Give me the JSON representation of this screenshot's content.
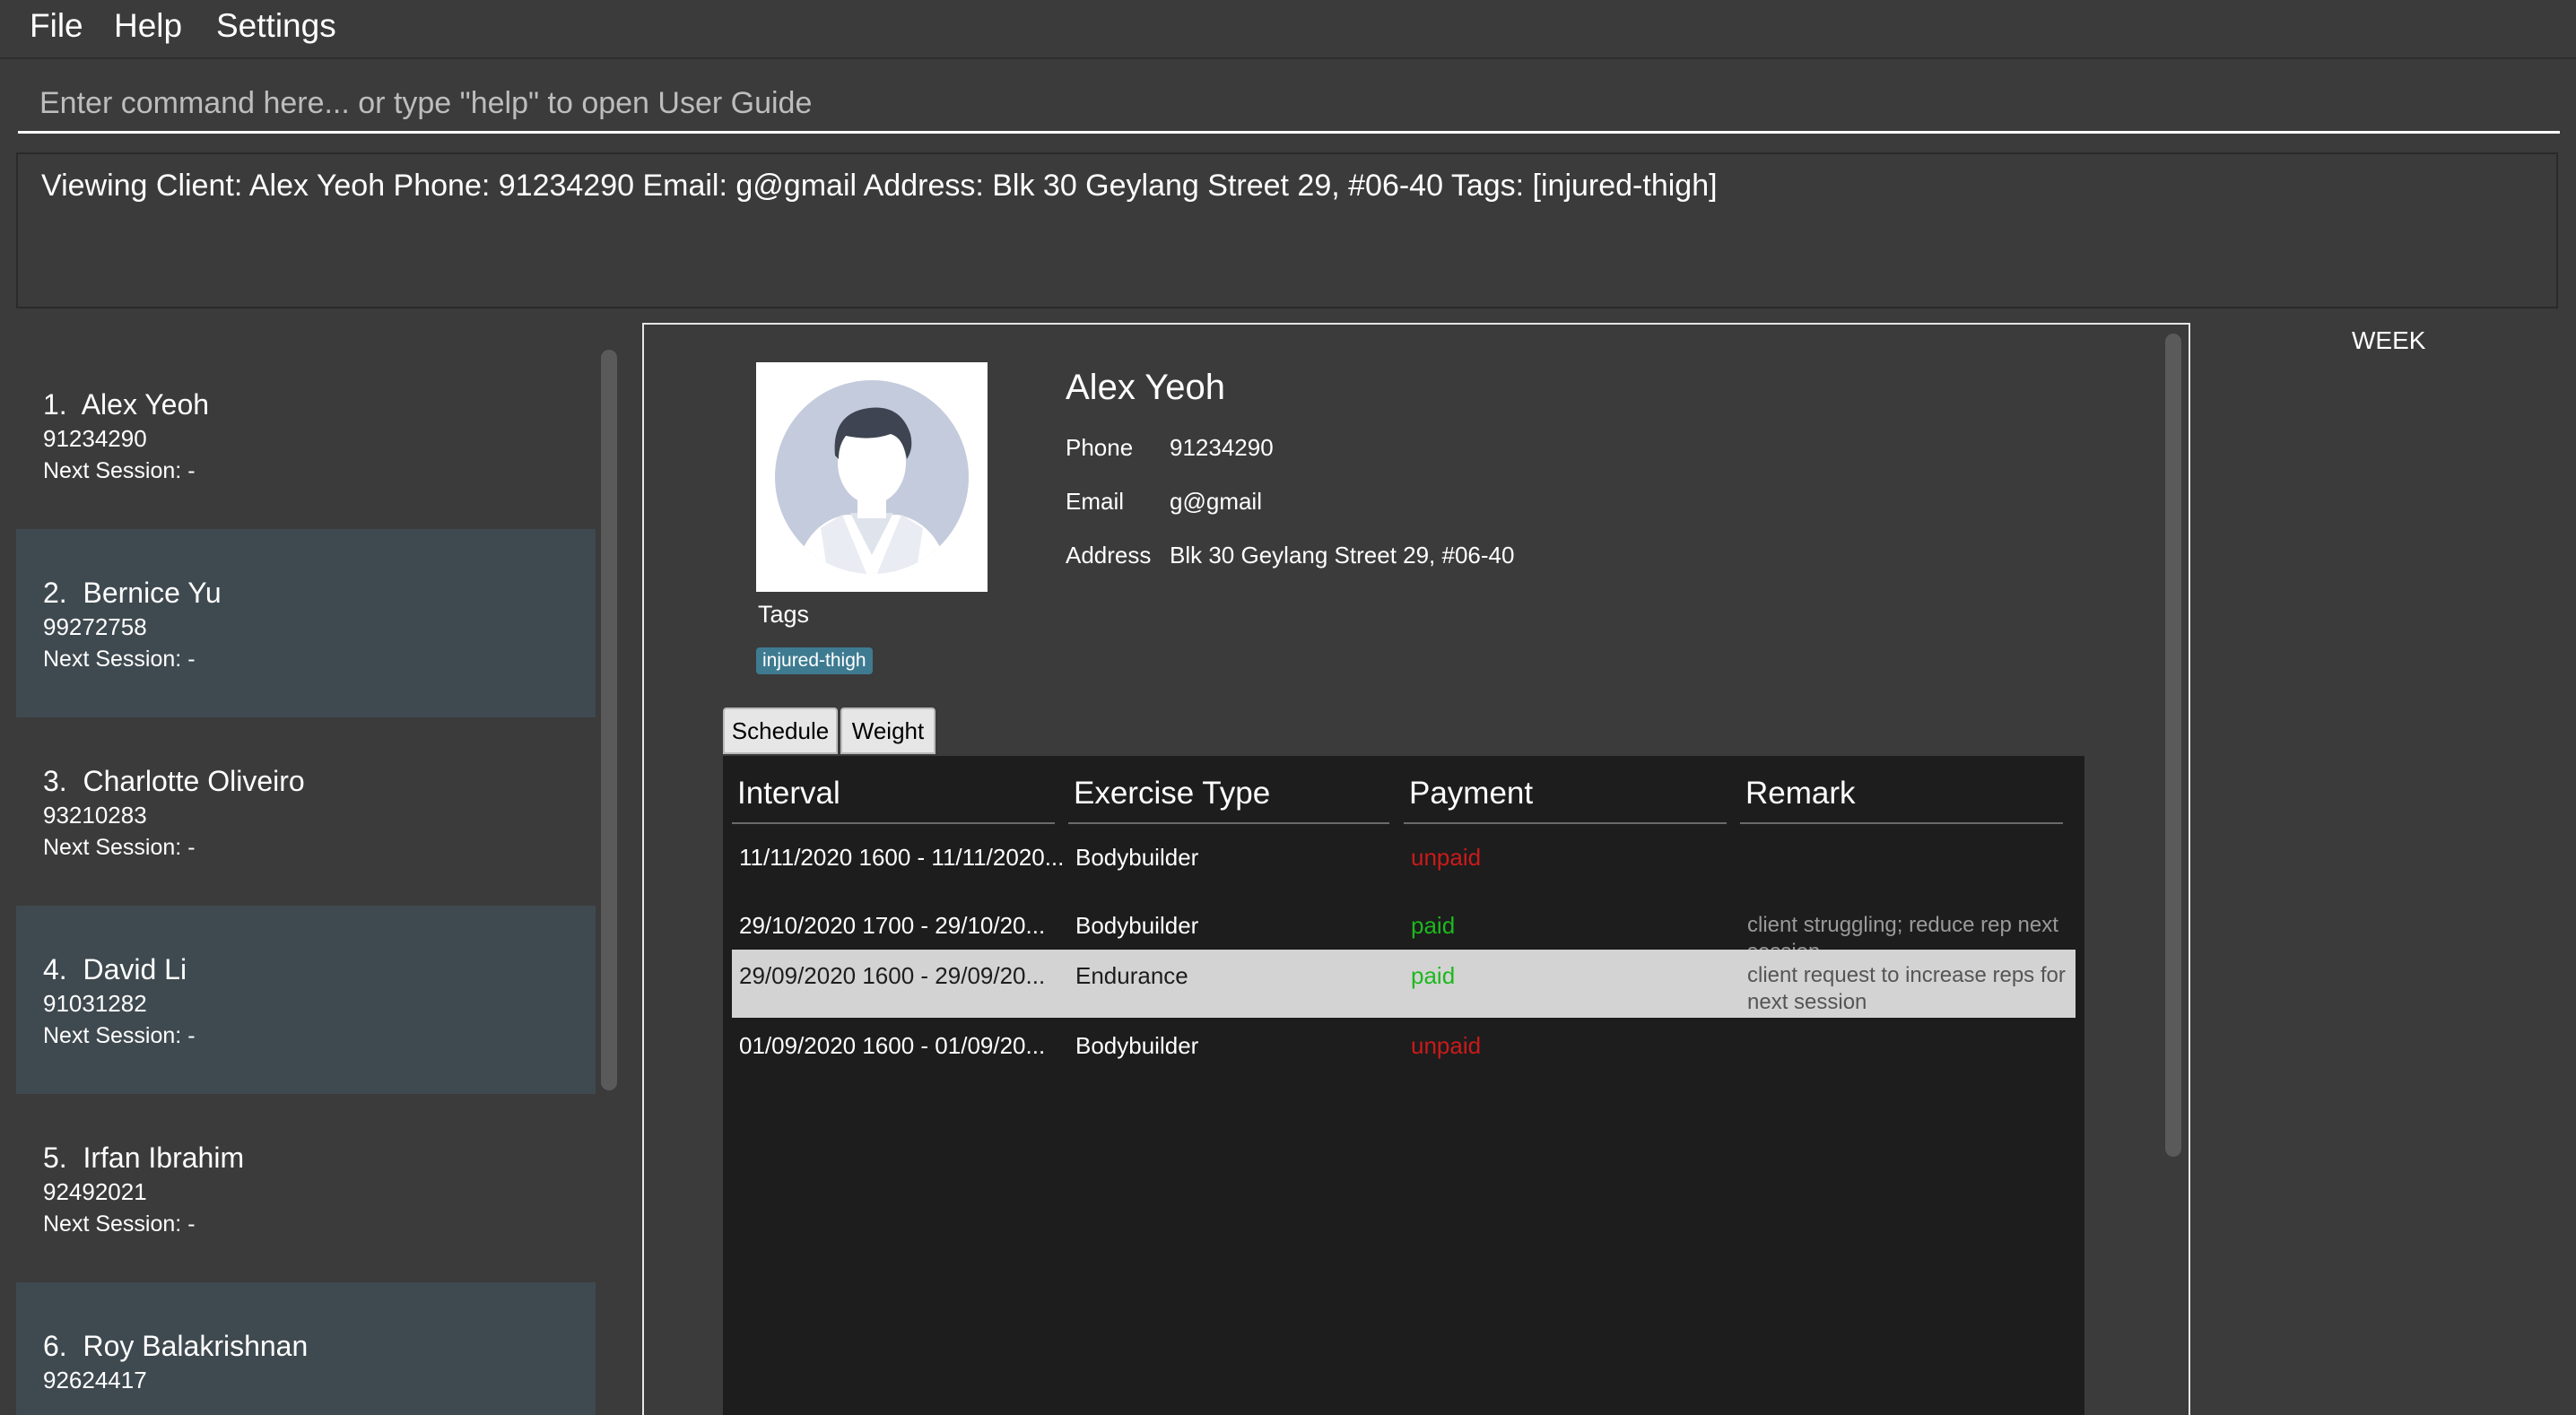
{
  "menu": {
    "items": [
      "File",
      "Help",
      "Settings"
    ]
  },
  "command_box": {
    "placeholder": "Enter command here... or type \"help\" to open User Guide",
    "value": ""
  },
  "result_display": {
    "text": "Viewing Client: Alex Yeoh Phone: 91234290 Email: g@gmail Address: Blk 30 Geylang Street 29, #06-40 Tags: [injured-thigh]"
  },
  "client_list": {
    "next_session_label": "Next Session:",
    "items": [
      {
        "index": "1.",
        "name": "Alex Yeoh",
        "phone": "91234290",
        "next_session": "-"
      },
      {
        "index": "2.",
        "name": "Bernice Yu",
        "phone": "99272758",
        "next_session": "-"
      },
      {
        "index": "3.",
        "name": "Charlotte Oliveiro",
        "phone": "93210283",
        "next_session": "-"
      },
      {
        "index": "4.",
        "name": "David Li",
        "phone": "91031282",
        "next_session": "-"
      },
      {
        "index": "5.",
        "name": "Irfan Ibrahim",
        "phone": "92492021",
        "next_session": "-"
      },
      {
        "index": "6.",
        "name": "Roy Balakrishnan",
        "phone": "92624417",
        "next_session": ""
      }
    ]
  },
  "client_detail": {
    "name": "Alex Yeoh",
    "phone_label": "Phone",
    "phone": "91234290",
    "email_label": "Email",
    "email": "g@gmail",
    "address_label": "Address",
    "address": "Blk 30 Geylang Street 29, #06-40",
    "tags_label": "Tags",
    "tags": [
      "injured-thigh"
    ]
  },
  "tabs": [
    {
      "label": "Schedule",
      "active": true
    },
    {
      "label": "Weight",
      "active": false
    }
  ],
  "schedule_table": {
    "headers": [
      "Interval",
      "Exercise Type",
      "Payment",
      "Remark"
    ],
    "rows": [
      {
        "interval": "11/11/2020 1600 - 11/11/2020...",
        "exercise": "Bodybuilder",
        "payment": "unpaid",
        "remark": ""
      },
      {
        "interval": "29/10/2020 1700 - 29/10/20...",
        "exercise": "Bodybuilder",
        "payment": "paid",
        "remark": "client struggling; reduce rep next session"
      },
      {
        "interval": "29/09/2020 1600 - 29/09/20...",
        "exercise": "Endurance",
        "payment": "paid",
        "remark": "client request to increase reps for next session",
        "selected": true
      },
      {
        "interval": "01/09/2020 1600 - 01/09/20...",
        "exercise": "Bodybuilder",
        "payment": "unpaid",
        "remark": ""
      }
    ]
  },
  "calendar": {
    "view_label": "WEEK"
  },
  "colors": {
    "background": "#3b3b3b",
    "card_alt": "#3f4a50",
    "table_bg": "#1d1d1d",
    "tag": "#3e7b91",
    "paid": "#1db81d",
    "unpaid": "#cc1a1a",
    "selected_row": "#d3d3d3"
  },
  "icons": {
    "avatar": "person-placeholder-icon"
  }
}
